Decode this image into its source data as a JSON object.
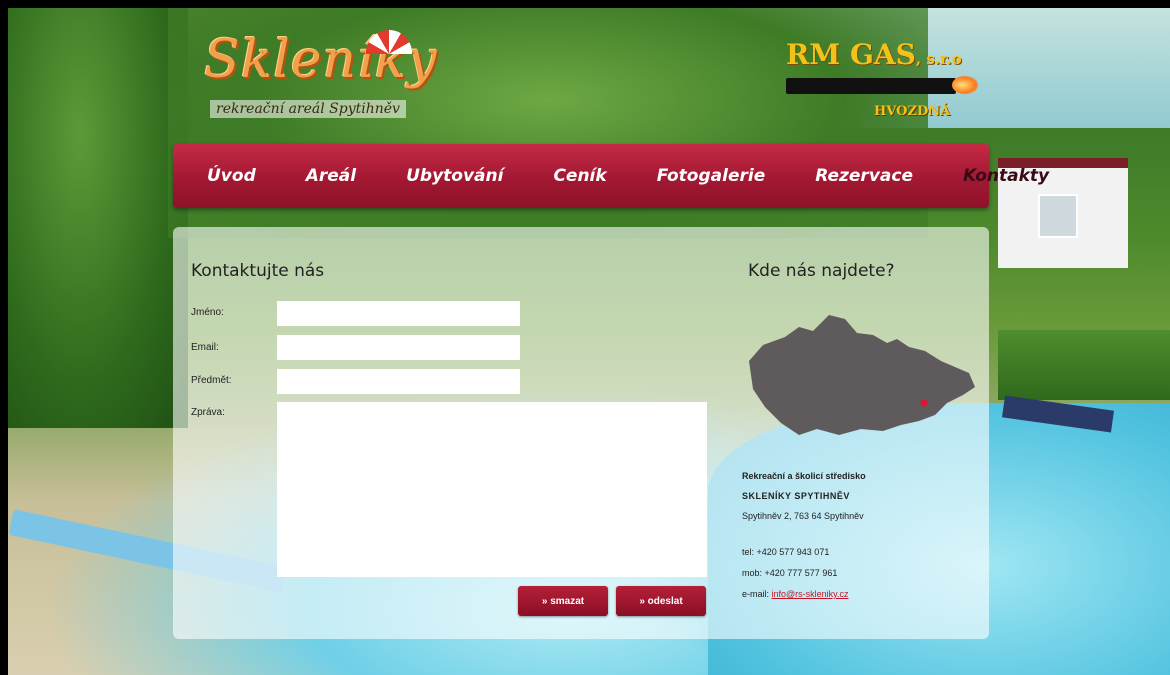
{
  "branding": {
    "logo_title": "Skleníky",
    "logo_subtitle": "rekreační areál Spytihněv",
    "sponsor_name": "RM GAS",
    "sponsor_suffix": ", s.r.o",
    "sponsor_city": "HVOZDNÁ"
  },
  "nav": {
    "items": [
      {
        "label": "Úvod"
      },
      {
        "label": "Areál"
      },
      {
        "label": "Ubytování"
      },
      {
        "label": "Ceník"
      },
      {
        "label": "Fotogalerie"
      },
      {
        "label": "Rezervace"
      },
      {
        "label": "Kontakty"
      }
    ],
    "active": "Kontakty"
  },
  "form": {
    "heading": "Kontaktujte nás",
    "name_label": "Jméno:",
    "name_value": "",
    "email_label": "Email:",
    "email_value": "",
    "subject_label": "Předmět:",
    "subject_value": "",
    "message_label": "Zpráva:",
    "message_value": "",
    "reset_label": "» smazat",
    "submit_label": "» odeslat"
  },
  "location": {
    "heading": "Kde nás najdete?",
    "org_line1": "Rekreační a školicí středisko",
    "org_line2": "SKLENÍKY SPYTIHNĚV",
    "address": "Spytihněv 2, 763 64 Spytihněv",
    "tel": "tel: +420 577 943 071",
    "mob": "mob: +420 777 577 961",
    "email_prefix": "e-mail: ",
    "email": "info@rs-skleniky.cz",
    "map_color": "#5f5a5b",
    "marker_color": "#e0142d"
  }
}
